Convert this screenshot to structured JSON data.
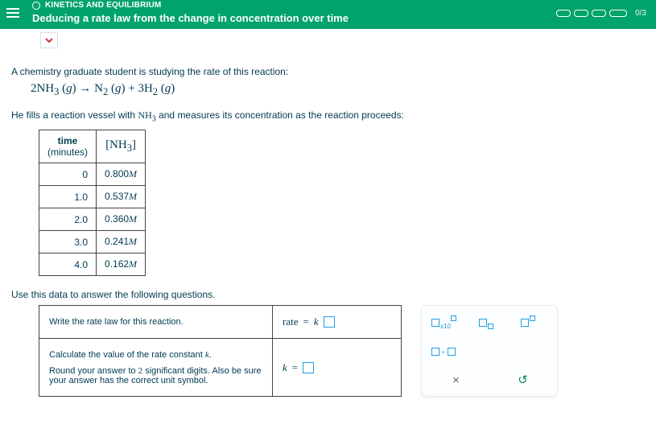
{
  "header": {
    "category": "KINETICS AND EQUILIBRIUM",
    "title": "Deducing a rate law from the change in concentration over time",
    "progress_text": "0/3"
  },
  "body": {
    "intro1": "A chemistry graduate student is studying the rate of this reaction:",
    "equation_html": "2NH₃ (g) → N₂ (g) + 3H₂ (g)",
    "intro2_a": "He fills a reaction vessel with ",
    "intro2_species": "NH₃",
    "intro2_b": " and measures its concentration as the reaction proceeds:",
    "table_head_time_a": "time",
    "table_head_time_b": "(minutes)",
    "table_head_conc": "[NH₃]",
    "rows": [
      {
        "t": "0",
        "c": "0.800",
        "u": "M"
      },
      {
        "t": "1.0",
        "c": "0.537",
        "u": "M"
      },
      {
        "t": "2.0",
        "c": "0.360",
        "u": "M"
      },
      {
        "t": "3.0",
        "c": "0.241",
        "u": "M"
      },
      {
        "t": "4.0",
        "c": "0.162",
        "u": "M"
      }
    ],
    "followup": "Use this data to answer the following questions.",
    "q1_prompt": "Write the rate law for this reaction.",
    "q1_rate_label": "rate",
    "q1_eq": "=",
    "q1_k": "k",
    "q2_prompt_a": "Calculate the value of the rate constant ",
    "q2_prompt_k": "k",
    "q2_prompt_b": ".",
    "q2_hint_a": "Round your answer to ",
    "q2_hint_digits": "2",
    "q2_hint_b": " significant digits. Also be sure your answer has the correct unit symbol.",
    "q2_k_label": "k",
    "q2_eq": "="
  },
  "palette": {
    "x10_label": "x10",
    "times_glyph": "×",
    "redo_glyph": "↺"
  }
}
